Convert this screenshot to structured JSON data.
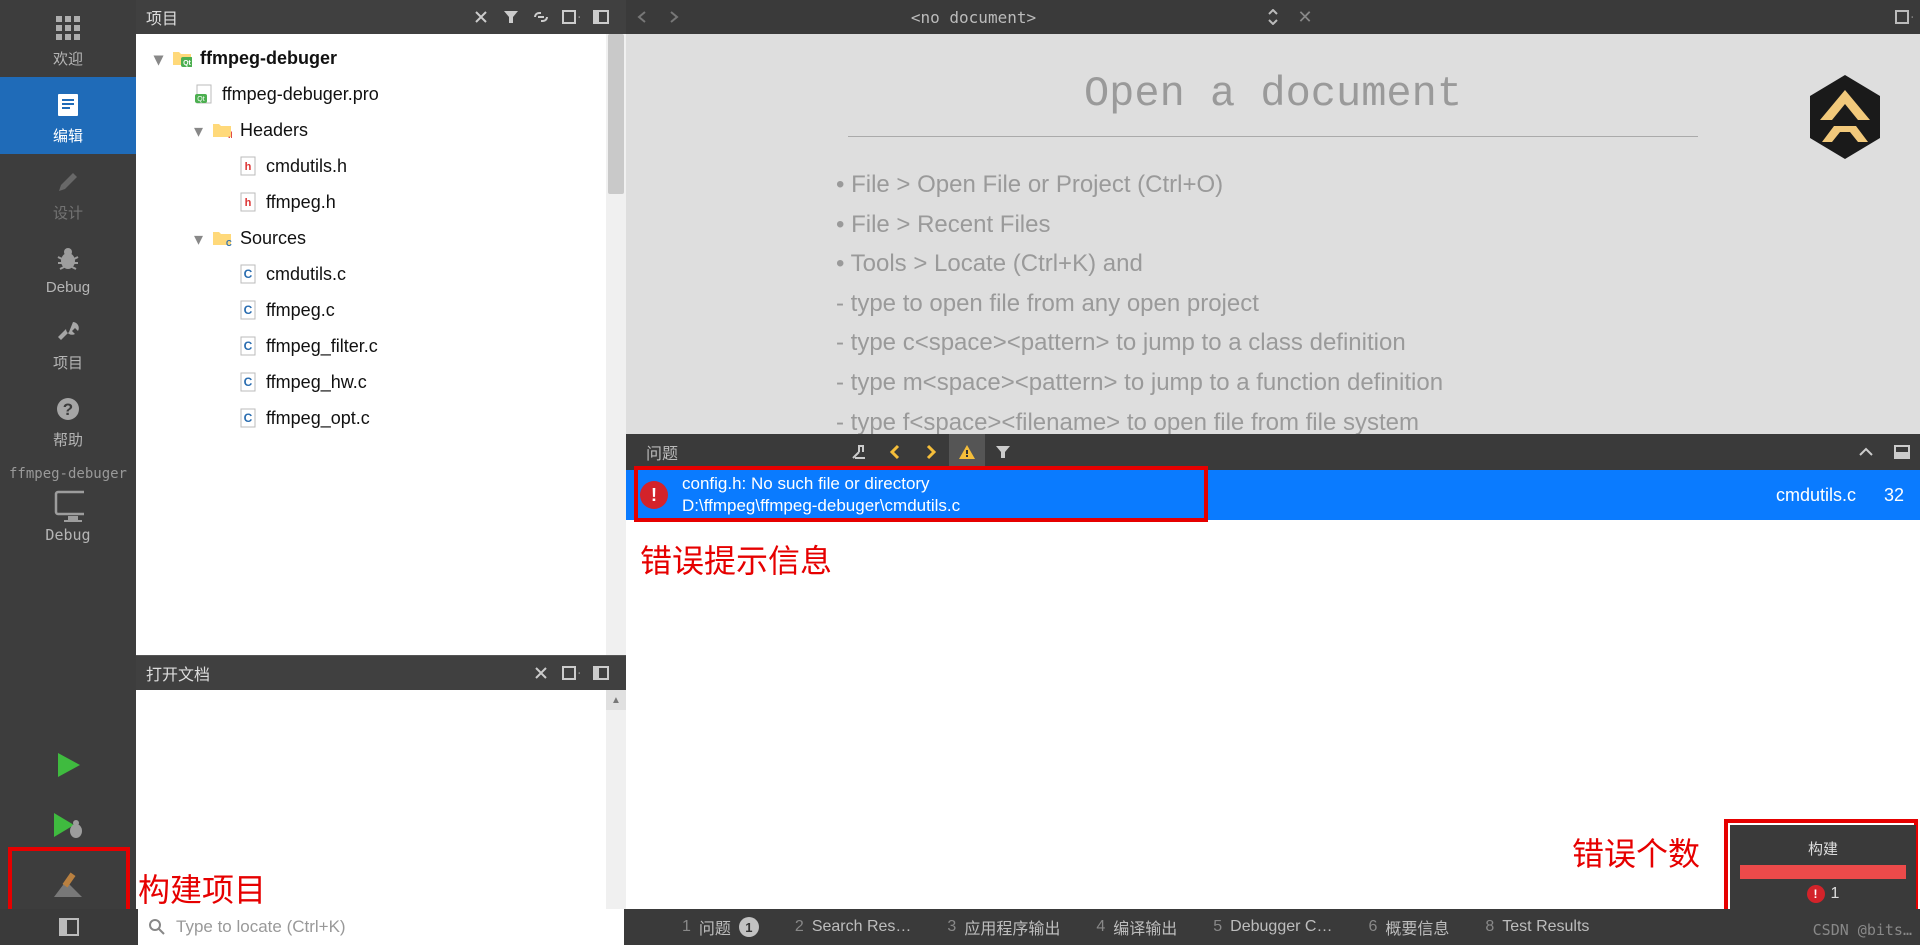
{
  "sidebar_nav": {
    "welcome": "欢迎",
    "edit": "编辑",
    "design": "设计",
    "debug": "Debug",
    "project": "项目",
    "help": "帮助"
  },
  "sidebar_project": "ffmpeg-debuger",
  "sidebar_bottom_label": "Debug",
  "project_panel": {
    "title": "项目",
    "tree": {
      "root": "ffmpeg-debuger",
      "pro_file": "ffmpeg-debuger.pro",
      "headers_label": "Headers",
      "headers": [
        "cmdutils.h",
        "ffmpeg.h"
      ],
      "sources_label": "Sources",
      "sources": [
        "cmdutils.c",
        "ffmpeg.c",
        "ffmpeg_filter.c",
        "ffmpeg_hw.c",
        "ffmpeg_opt.c"
      ]
    }
  },
  "open_docs_title": "打开文档",
  "editor": {
    "no_document": "<no document>",
    "welcome_title": "Open a document",
    "hint1": "• File > Open File or Project (Ctrl+O)",
    "hint2": "• File > Recent Files",
    "hint3": "• Tools > Locate (Ctrl+K) and",
    "hint4": "  - type to open file from any open project",
    "hint5": "  - type c<space><pattern> to jump to a class definition",
    "hint6": "  - type m<space><pattern> to jump to a function definition",
    "hint7": "  - type f<space><filename> to open file from file system"
  },
  "problems": {
    "title": "问题",
    "error_msg": "config.h: No such file or directory",
    "error_path": "D:\\ffmpeg\\ffmpeg-debuger\\cmdutils.c",
    "file": "cmdutils.c",
    "line": "32"
  },
  "build_popup": {
    "title": "构建",
    "error_count": "1"
  },
  "status_bar": {
    "search_placeholder": "Type to locate (Ctrl+K)",
    "tabs": {
      "t1": "问题",
      "b1": "1",
      "t2": "Search Res…",
      "t3": "应用程序输出",
      "t4": "编译输出",
      "t5": "Debugger C…",
      "t6": "概要信息",
      "t8": "Test Results"
    }
  },
  "annotations": {
    "error_info": "错误提示信息",
    "error_count": "错误个数",
    "build_project": "构建项目"
  },
  "watermark": "CSDN @bits…"
}
